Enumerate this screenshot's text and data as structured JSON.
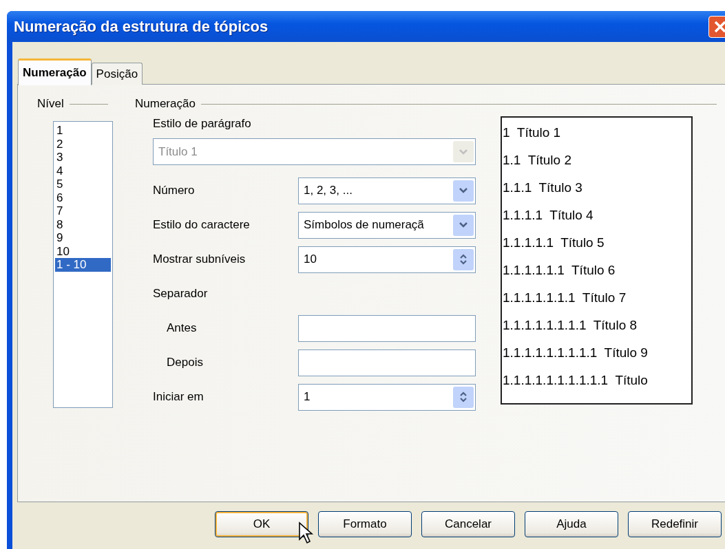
{
  "window": {
    "title": "Numeração da estrutura de tópicos"
  },
  "tabs": [
    {
      "label": "Numeração",
      "selected": true
    },
    {
      "label": "Posição",
      "selected": false
    }
  ],
  "level": {
    "label": "Nível",
    "items": [
      {
        "label": "1",
        "selected": false
      },
      {
        "label": "2",
        "selected": false
      },
      {
        "label": "3",
        "selected": false
      },
      {
        "label": "4",
        "selected": false
      },
      {
        "label": "5",
        "selected": false
      },
      {
        "label": "6",
        "selected": false
      },
      {
        "label": "7",
        "selected": false
      },
      {
        "label": "8",
        "selected": false
      },
      {
        "label": "9",
        "selected": false
      },
      {
        "label": "10",
        "selected": false
      },
      {
        "label": "1 - 10",
        "selected": true
      }
    ]
  },
  "numbering": {
    "label": "Numeração",
    "paragraph_style": {
      "label": "Estilo de parágrafo",
      "value": "Título 1",
      "disabled": true
    },
    "rows": [
      {
        "kind": "dropdown",
        "label": "Número",
        "value": "1, 2, 3, ..."
      },
      {
        "kind": "dropdown",
        "label": "Estilo do caractere",
        "value": "Símbolos de numeraçã"
      },
      {
        "kind": "spin",
        "label": "Mostrar subníveis",
        "value": "10"
      },
      {
        "kind": "heading",
        "label": "Separador"
      },
      {
        "kind": "text",
        "label": "Antes"
      },
      {
        "kind": "text",
        "label": "Depois"
      },
      {
        "kind": "spin",
        "label": "Iniciar em",
        "value": "1"
      }
    ]
  },
  "preview": [
    "1  Título 1",
    "1.1  Título 2",
    "1.1.1  Título 3",
    "1.1.1.1  Título 4",
    "1.1.1.1.1  Título 5",
    "1.1.1.1.1.1  Título 6",
    "1.1.1.1.1.1.1  Título 7",
    "1.1.1.1.1.1.1.1  Título 8",
    "1.1.1.1.1.1.1.1.1  Título 9",
    "1.1.1.1.1.1.1.1.1.1  Título"
  ],
  "buttons": [
    {
      "label": "OK",
      "default": true
    },
    {
      "label": "Formato",
      "default": false
    },
    {
      "label": "Cancelar",
      "default": false
    },
    {
      "label": "Ajuda",
      "default": false
    },
    {
      "label": "Redefinir",
      "default": false
    }
  ]
}
